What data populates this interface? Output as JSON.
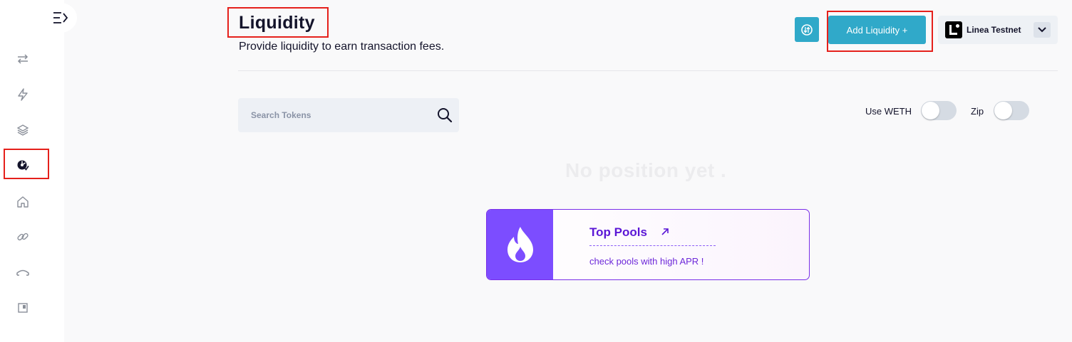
{
  "header": {
    "title": "Liquidity",
    "subtitle": "Provide liquidity to earn transaction fees.",
    "add_liquidity_label": "Add Liquidity +",
    "network_name": "Linea Testnet"
  },
  "sidebar": {
    "items": [
      {
        "icon": "swap-arrows-icon"
      },
      {
        "icon": "lightning-icon"
      },
      {
        "icon": "layers-icon"
      },
      {
        "icon": "liquidity-icon",
        "active": true
      },
      {
        "icon": "home-icon"
      },
      {
        "icon": "link-icon"
      },
      {
        "icon": "bridge-icon"
      },
      {
        "icon": "square-icon"
      }
    ]
  },
  "search": {
    "placeholder": "Search Tokens"
  },
  "toggles": [
    {
      "label": "Use WETH",
      "on": false
    },
    {
      "label": "Zip",
      "on": false
    }
  ],
  "empty_state": {
    "message": "No position yet ."
  },
  "top_pools": {
    "title": "Top Pools",
    "subtitle": "check pools with high APR !"
  },
  "colors": {
    "accent": "#30a9c9",
    "highlight": "#e5201b",
    "pool_purple": "#7c4dff"
  }
}
